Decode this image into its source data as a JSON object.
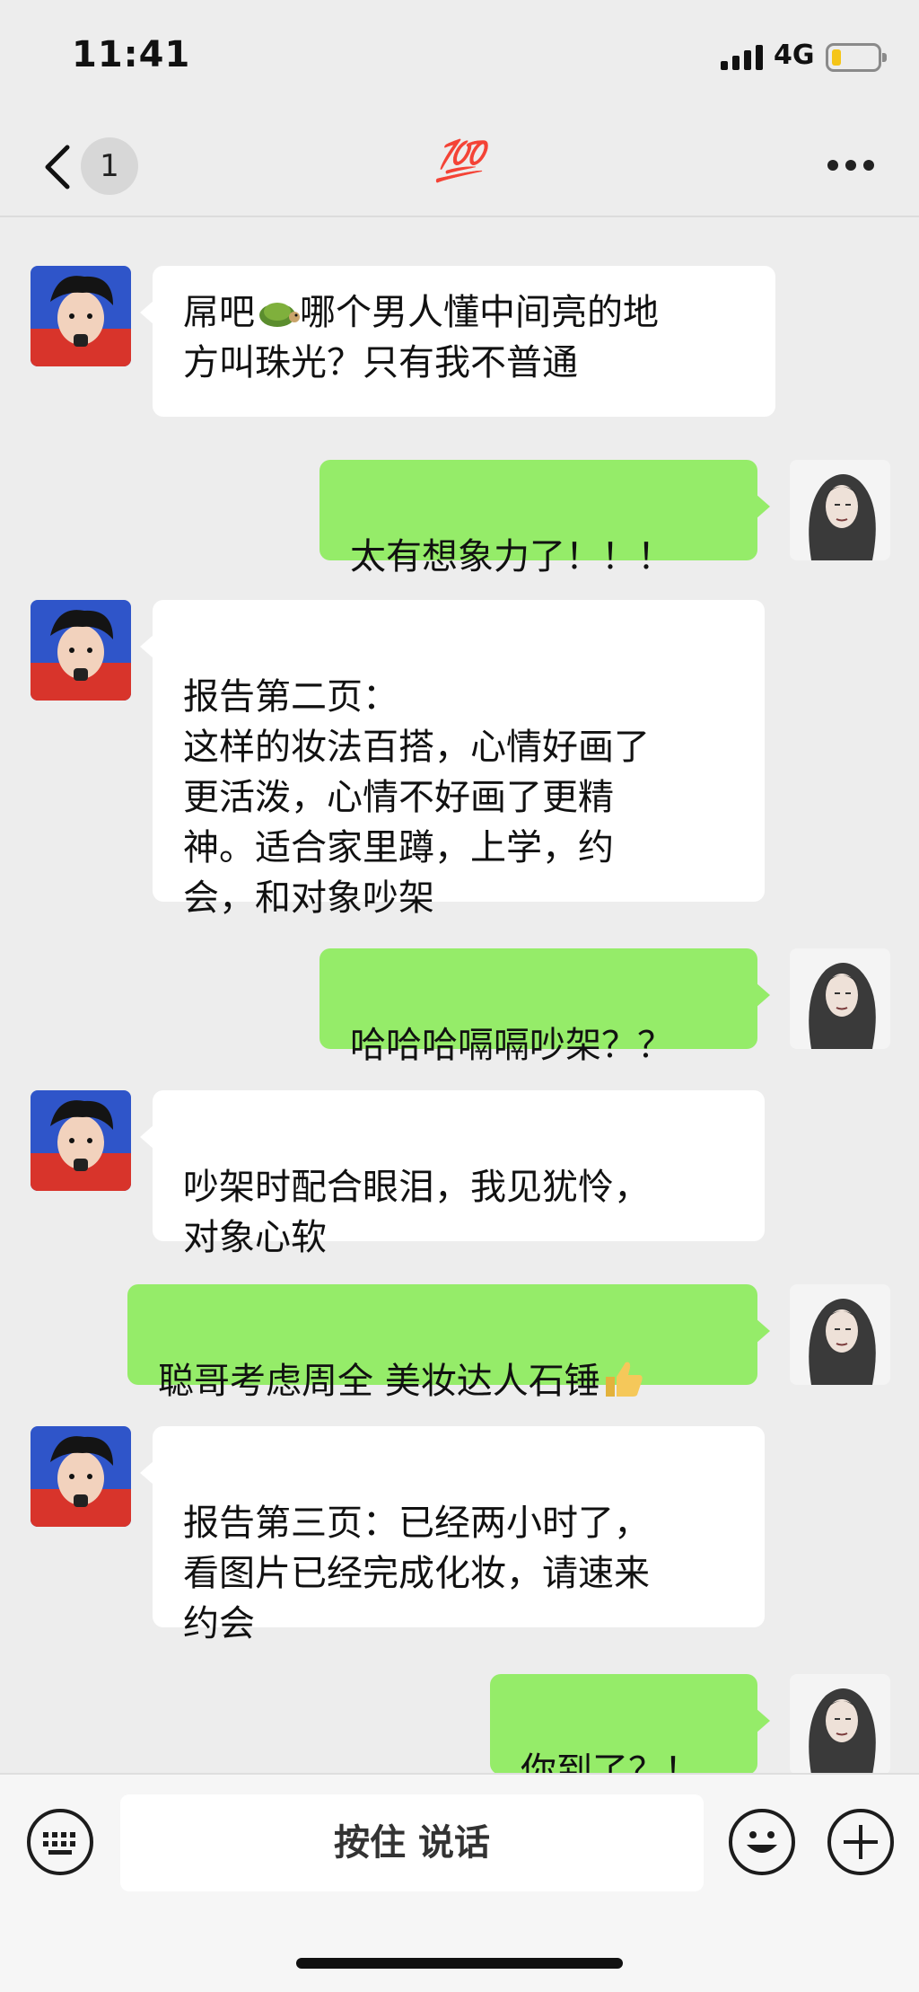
{
  "status_bar": {
    "time": "11:41",
    "network": "4G",
    "battery_level": 0.2
  },
  "nav": {
    "unread_count": "1",
    "title": "💯",
    "back_icon": "chevron-left-icon",
    "more_icon": "ellipsis-icon"
  },
  "messages": [
    {
      "side": "in",
      "text_before": "屌吧",
      "emoji": "turtle-icon",
      "text_after": "哪个男人懂中间亮的地\n方叫珠光？只有我不普通"
    },
    {
      "side": "out",
      "text": "太有想象力了！！！"
    },
    {
      "side": "in",
      "text": "报告第二页：\n这样的妆法百搭，心情好画了\n更活泼，心情不好画了更精\n神。适合家里蹲，上学，约\n会，和对象吵架"
    },
    {
      "side": "out",
      "text": "哈哈哈嗝嗝吵架？？"
    },
    {
      "side": "in",
      "text": "吵架时配合眼泪，我见犹怜，\n对象心软"
    },
    {
      "side": "out",
      "text": "聪哥考虑周全 美妆达人石锤",
      "emoji": "thumbs-up-icon"
    },
    {
      "side": "in",
      "text": "报告第三页：已经两小时了，\n看图片已经完成化妆，请速来\n约会"
    },
    {
      "side": "out",
      "text": "你到了？！"
    }
  ],
  "input_bar": {
    "voice_label": "按住 说话",
    "left_icon": "keyboard-icon",
    "emoji_icon": "smiley-icon",
    "plus_icon": "plus-icon"
  },
  "colors": {
    "outgoing_bubble": "#95ec69",
    "incoming_bubble": "#ffffff",
    "background": "#ededed"
  }
}
